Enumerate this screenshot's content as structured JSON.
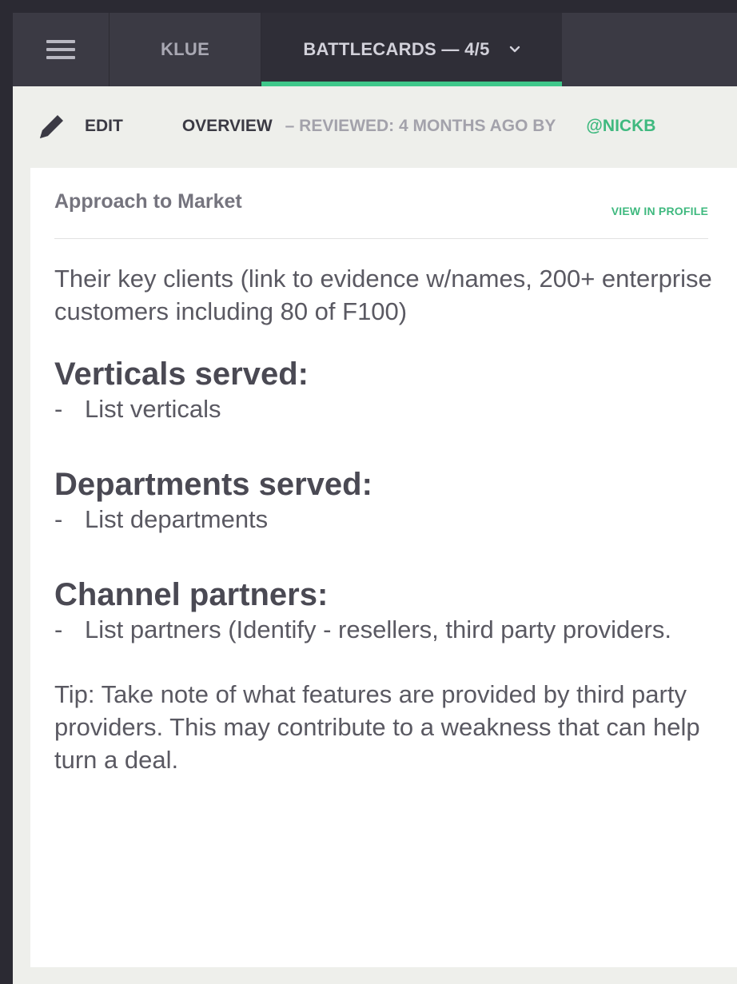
{
  "nav": {
    "klue_label": "KLUE",
    "battlecards_label": "BATTLECARDS — 4/5"
  },
  "subbar": {
    "edit_label": "EDIT",
    "overview_label": "OVERVIEW",
    "reviewed_text": "– REVIEWED: 4 MONTHS AGO BY",
    "reviewer": "@NICKB"
  },
  "card": {
    "title": "Approach to Market",
    "view_profile_label": "VIEW IN PROFILE",
    "intro": "Their key clients (link to evidence w/names, 200+ enterprise customers including 80 of F100)",
    "sections": [
      {
        "heading": "Verticals served:",
        "bullet": "List verticals"
      },
      {
        "heading": "Departments served:",
        "bullet": "List departments"
      },
      {
        "heading": "Channel partners:",
        "bullet": "List partners (Identify - resellers, third party providers."
      }
    ],
    "bullet_dash": "-",
    "tip": "Tip: Take note of what features are provided by third party providers.  This may contribute to a weakness that can help turn a deal."
  },
  "colors": {
    "accent_green": "#3fc78a",
    "nav_bg": "#3b3a44",
    "active_tab_bg": "#2f2e37"
  }
}
